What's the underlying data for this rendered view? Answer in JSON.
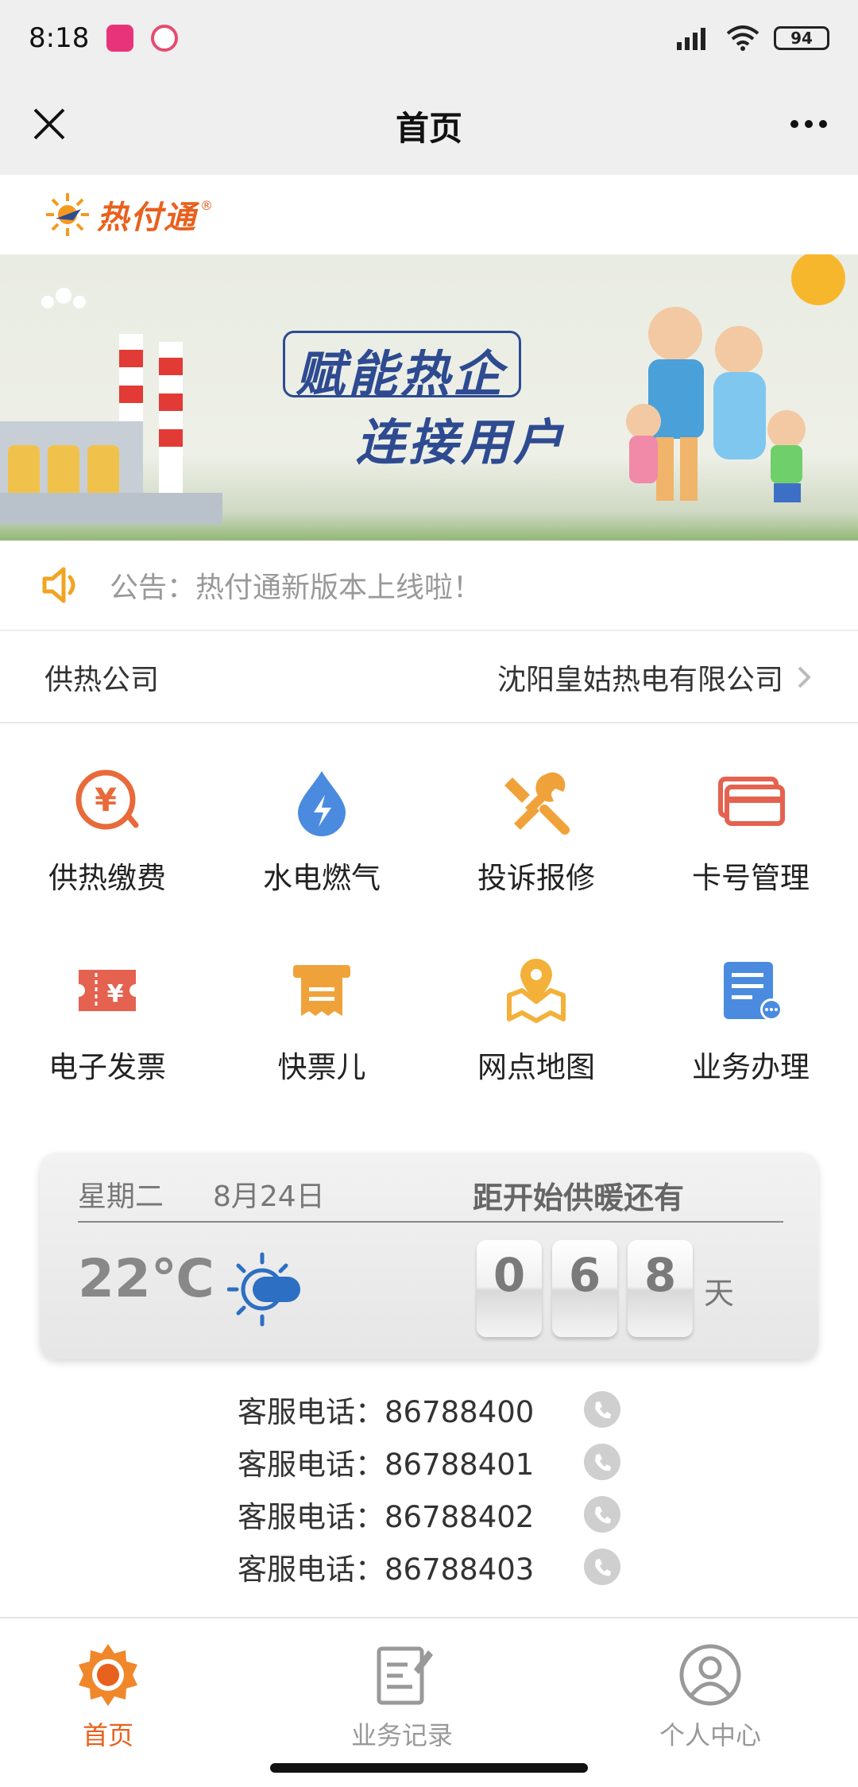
{
  "status_bar": {
    "time": "8:18",
    "battery": "94"
  },
  "nav": {
    "title": "首页"
  },
  "logo": {
    "text": "热付通",
    "reg": "®"
  },
  "banner": {
    "line1": "赋能热企",
    "line2": "连接用户"
  },
  "notice": {
    "text": "公告：热付通新版本上线啦！"
  },
  "company": {
    "label": "供热公司",
    "value": "沈阳皇姑热电有限公司"
  },
  "services": [
    {
      "label": "供热缴费",
      "icon": "yuan-icon",
      "color": "#e86a3a"
    },
    {
      "label": "水电燃气",
      "icon": "drop-lightning-icon",
      "color": "#4a8be0"
    },
    {
      "label": "投诉报修",
      "icon": "tools-icon",
      "color": "#f0a23a"
    },
    {
      "label": "卡号管理",
      "icon": "card-icon",
      "color": "#e4624f"
    },
    {
      "label": "电子发票",
      "icon": "ticket-icon",
      "color": "#e4624f"
    },
    {
      "label": "快票儿",
      "icon": "receipt-printer-icon",
      "color": "#f0a23a"
    },
    {
      "label": "网点地图",
      "icon": "map-pin-icon",
      "color": "#f3b13a"
    },
    {
      "label": "业务办理",
      "icon": "document-icon",
      "color": "#4a8be0"
    }
  ],
  "weather": {
    "day": "星期二",
    "date": "8月24日",
    "temperature": "22℃",
    "countdown_label": "距开始供暖还有",
    "digits": [
      "0",
      "6",
      "8"
    ],
    "unit": "天"
  },
  "hotlines": [
    {
      "text": "客服电话：86788400"
    },
    {
      "text": "客服电话：86788401"
    },
    {
      "text": "客服电话：86788402"
    },
    {
      "text": "客服电话：86788403"
    }
  ],
  "tabs": [
    {
      "label": "首页",
      "active": true
    },
    {
      "label": "业务记录",
      "active": false
    },
    {
      "label": "个人中心",
      "active": false
    }
  ],
  "colors": {
    "accent": "#e8611d",
    "banner_text": "#2e4b91"
  }
}
